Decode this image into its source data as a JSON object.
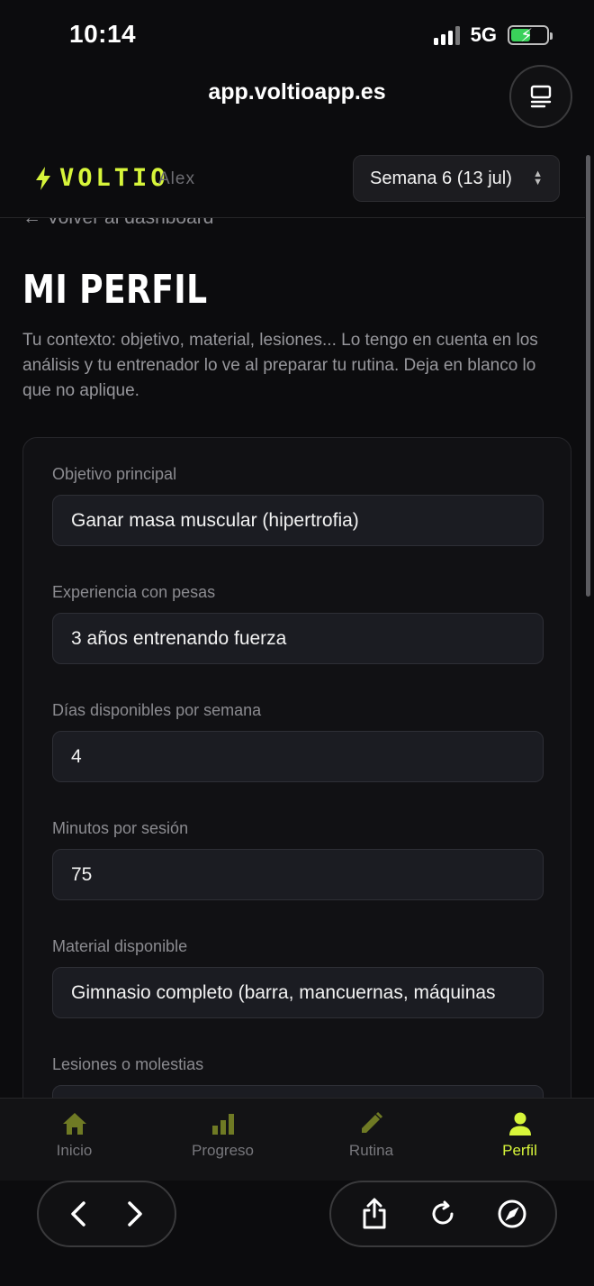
{
  "status_bar": {
    "time": "10:14",
    "network": "5G"
  },
  "browser": {
    "url": "app.voltioapp.es"
  },
  "header": {
    "logo_text": "VOLTIO",
    "username": "Alex",
    "week_selector": "Semana 6 (13 jul)"
  },
  "page": {
    "back_link": "← Volver al dashboard",
    "title": "MI PERFIL",
    "description": "Tu contexto: objetivo, material, lesiones... Lo tengo en cuenta en los análisis y tu entrenador lo ve al preparar tu rutina. Deja en blanco lo que no aplique."
  },
  "form": {
    "fields": [
      {
        "label": "Objetivo principal",
        "value": "Ganar masa muscular (hipertrofia)"
      },
      {
        "label": "Experiencia con pesas",
        "value": "3 años entrenando fuerza"
      },
      {
        "label": "Días disponibles por semana",
        "value": "4"
      },
      {
        "label": "Minutos por sesión",
        "value": "75"
      },
      {
        "label": "Material disponible",
        "value": "Gimnasio completo (barra, mancuernas, máquinas"
      },
      {
        "label": "Lesiones o molestias",
        "value": ""
      }
    ]
  },
  "tabs": [
    {
      "label": "Inicio",
      "icon": "home-icon",
      "active": false
    },
    {
      "label": "Progreso",
      "icon": "bar-chart-icon",
      "active": false
    },
    {
      "label": "Rutina",
      "icon": "pencil-icon",
      "active": false
    },
    {
      "label": "Perfil",
      "icon": "person-icon",
      "active": true
    }
  ],
  "colors": {
    "accent": "#d7f53a",
    "tab_icon_inactive": "#6f7a24",
    "background": "#0c0c0e",
    "card": "#111114",
    "input": "#1b1c22"
  }
}
